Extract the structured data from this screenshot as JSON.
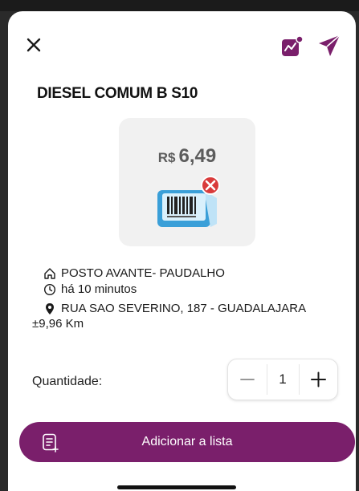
{
  "product": {
    "title": "DIESEL COMUM B S10"
  },
  "price": {
    "currency": "R$",
    "value": "6,49"
  },
  "station": {
    "name": "POSTO AVANTE- PAUDALHO",
    "updated": "há 10 minutos",
    "address": "RUA SAO SEVERINO, 187 - GUADALAJARA",
    "distance": "±9,96 Km"
  },
  "quantity": {
    "label": "Quantidade:",
    "value": "1"
  },
  "actions": {
    "add_label": "Adicionar a lista"
  },
  "colors": {
    "primary": "#7a1f6b",
    "error": "#d93b3b",
    "barcode_blue": "#3a9fd8"
  },
  "icons": {
    "close": "close-icon",
    "chart": "chart-icon",
    "send": "send-icon",
    "station": "home-icon",
    "time": "clock-icon",
    "location": "location-pin-icon",
    "list": "list-icon"
  }
}
